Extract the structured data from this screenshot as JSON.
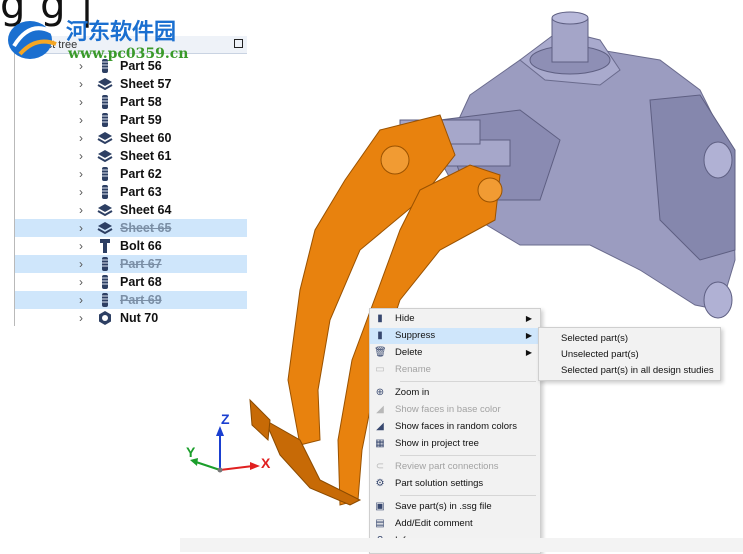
{
  "watermark": {
    "title": "河东软件园",
    "url": "www.pc0359.cn"
  },
  "background_text": "g         g |",
  "project_tree": {
    "title": "Project tree",
    "items": [
      {
        "label": "Part 56",
        "icon": "part-icon",
        "selected": false,
        "struck": false
      },
      {
        "label": "Sheet 57",
        "icon": "sheet-icon",
        "selected": false,
        "struck": false
      },
      {
        "label": "Part 58",
        "icon": "part-icon",
        "selected": false,
        "struck": false
      },
      {
        "label": "Part 59",
        "icon": "part-icon",
        "selected": false,
        "struck": false
      },
      {
        "label": "Sheet 60",
        "icon": "sheet-icon",
        "selected": false,
        "struck": false
      },
      {
        "label": "Sheet 61",
        "icon": "sheet-icon",
        "selected": false,
        "struck": false
      },
      {
        "label": "Part 62",
        "icon": "part-icon",
        "selected": false,
        "struck": false
      },
      {
        "label": "Part 63",
        "icon": "part-icon",
        "selected": false,
        "struck": false
      },
      {
        "label": "Sheet 64",
        "icon": "sheet-icon",
        "selected": false,
        "struck": false
      },
      {
        "label": "Sheet 65",
        "icon": "sheet-icon",
        "selected": true,
        "struck": true
      },
      {
        "label": "Bolt 66",
        "icon": "bolt-icon",
        "selected": false,
        "struck": false
      },
      {
        "label": "Part 67",
        "icon": "part-icon",
        "selected": true,
        "struck": true
      },
      {
        "label": "Part 68",
        "icon": "part-icon",
        "selected": false,
        "struck": false
      },
      {
        "label": "Part 69",
        "icon": "part-icon",
        "selected": true,
        "struck": true
      },
      {
        "label": "Nut 70",
        "icon": "nut-icon",
        "selected": false,
        "struck": false
      }
    ]
  },
  "axes": {
    "z": "Z",
    "y": "Y",
    "x": "X"
  },
  "context_menu": {
    "items": [
      {
        "label": "Hide",
        "icon": "hide-icon",
        "has_submenu": true,
        "disabled": false,
        "highlighted": false
      },
      {
        "label": "Suppress",
        "icon": "suppress-icon",
        "has_submenu": true,
        "disabled": false,
        "highlighted": true
      },
      {
        "label": "Delete",
        "icon": "trash-icon",
        "has_submenu": true,
        "disabled": false,
        "highlighted": false
      },
      {
        "label": "Rename",
        "icon": "rename-icon",
        "has_submenu": false,
        "disabled": true,
        "highlighted": false
      },
      {
        "label": "Zoom in",
        "icon": "zoom-in-icon",
        "has_submenu": false,
        "disabled": false,
        "highlighted": false
      },
      {
        "label": "Show faces in base color",
        "icon": "base-color-icon",
        "has_submenu": false,
        "disabled": true,
        "highlighted": false
      },
      {
        "label": "Show faces in random colors",
        "icon": "random-colors-icon",
        "has_submenu": false,
        "disabled": false,
        "highlighted": false
      },
      {
        "label": "Show in project tree",
        "icon": "tree-icon",
        "has_submenu": false,
        "disabled": false,
        "highlighted": false
      },
      {
        "label": "Review part connections",
        "icon": "connections-icon",
        "has_submenu": false,
        "disabled": true,
        "highlighted": false
      },
      {
        "label": "Part solution settings",
        "icon": "gear-icon",
        "has_submenu": false,
        "disabled": false,
        "highlighted": false
      },
      {
        "label": "Save part(s) in .ssg file",
        "icon": "save-icon",
        "has_submenu": false,
        "disabled": false,
        "highlighted": false
      },
      {
        "label": "Add/Edit comment",
        "icon": "comment-icon",
        "has_submenu": false,
        "disabled": false,
        "highlighted": false
      },
      {
        "label": "Info",
        "icon": "info-icon",
        "has_submenu": false,
        "disabled": false,
        "highlighted": false
      }
    ]
  },
  "submenu": {
    "items": [
      {
        "label": "Selected part(s)"
      },
      {
        "label": "Unselected part(s)"
      },
      {
        "label": "Selected part(s) in all design studies"
      }
    ]
  },
  "colors": {
    "selection": "#cfe6fb",
    "model_orange": "#e8820e",
    "model_purple": "#9b9cc0",
    "axis_x": "#e02020",
    "axis_y": "#1a9e2a",
    "axis_z": "#1a3fd0"
  }
}
